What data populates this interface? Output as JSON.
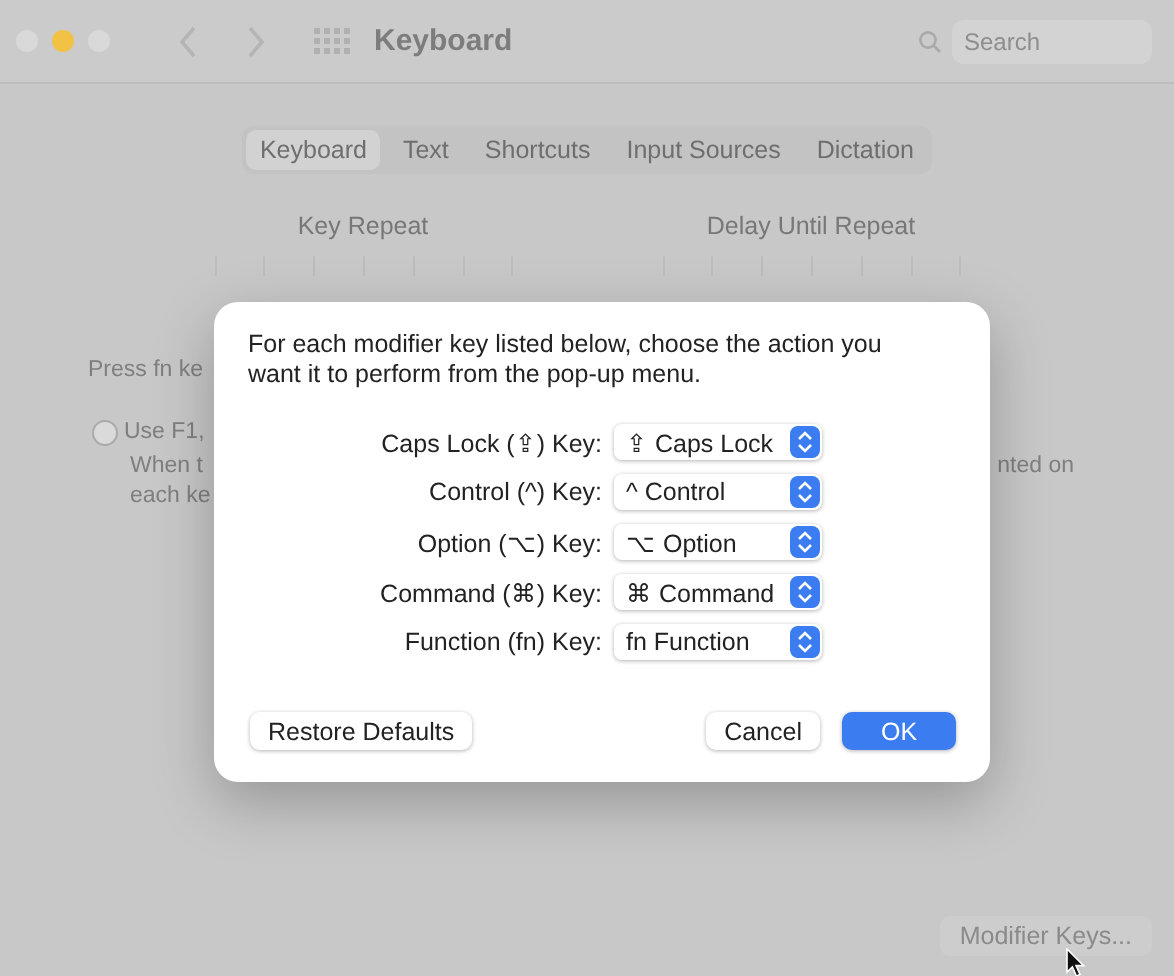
{
  "window": {
    "title": "Keyboard",
    "lights": [
      {
        "color": "#d9d9d9"
      },
      {
        "color": "#f2c245"
      },
      {
        "color": "#d9d9d9"
      }
    ]
  },
  "search": {
    "placeholder": "Search"
  },
  "tabs": [
    {
      "label": "Keyboard",
      "selected": true
    },
    {
      "label": "Text",
      "selected": false
    },
    {
      "label": "Shortcuts",
      "selected": false
    },
    {
      "label": "Input Sources",
      "selected": false
    },
    {
      "label": "Dictation",
      "selected": false
    }
  ],
  "headings": [
    "Key Repeat",
    "Delay Until Repeat"
  ],
  "background": {
    "fn_prompt": "Press fn ke",
    "option": {
      "label": "Use F1,",
      "checked": false
    },
    "description_left": [
      "When t",
      "each ke"
    ],
    "description_right": "nted on"
  },
  "dialog": {
    "message": "For each modifier key listed below, choose the action you want it to perform from the pop-up menu.",
    "rows": [
      {
        "label": "Caps Lock (⇪) Key:",
        "value": "⇪ Caps Lock"
      },
      {
        "label": "Control (^) Key:",
        "value": "^ Control"
      },
      {
        "label": "Option (⌥) Key:",
        "value": "⌥ Option"
      },
      {
        "label": "Command (⌘) Key:",
        "value": "⌘ Command"
      },
      {
        "label": "Function (fn) Key:",
        "value": "fn Function"
      }
    ],
    "buttons": [
      {
        "label": "Restore Defaults",
        "kind": "plain"
      },
      {
        "label": "Cancel",
        "kind": "plain"
      },
      {
        "label": "OK",
        "kind": "default"
      }
    ]
  },
  "footer_button": "Modifier Keys..."
}
